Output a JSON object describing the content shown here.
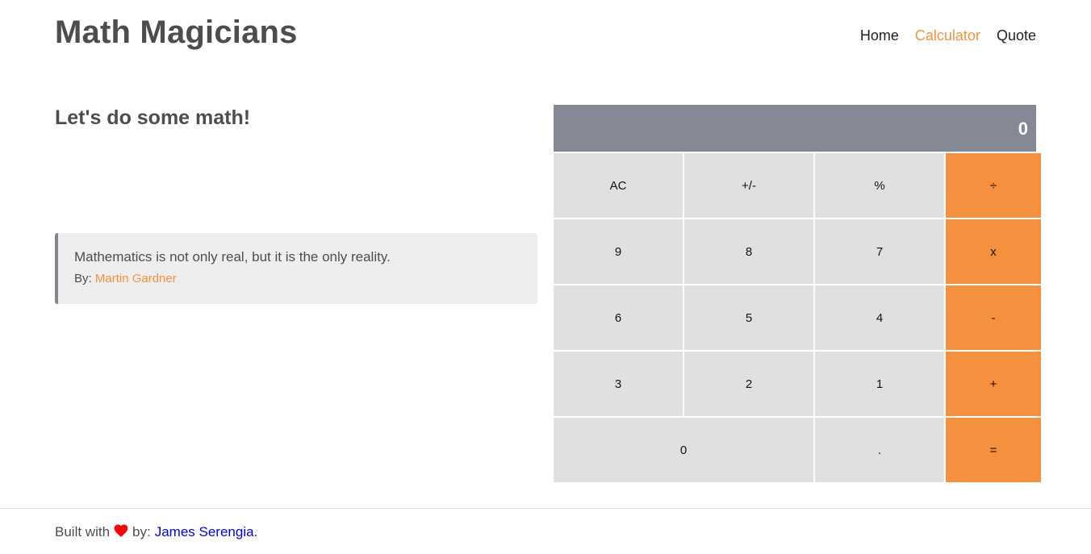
{
  "header": {
    "title": "Math Magicians",
    "nav": [
      {
        "label": "Home",
        "active": false
      },
      {
        "label": "Calculator",
        "active": true
      },
      {
        "label": "Quote",
        "active": false
      }
    ]
  },
  "main": {
    "heading": "Let's do some math!",
    "quote": {
      "text": "Mathematics is not only real, but it is the only reality.",
      "by_label": "By:",
      "author": "Martin Gardner"
    }
  },
  "calculator": {
    "display": "0",
    "keys": {
      "ac": "AC",
      "sign": "+/-",
      "percent": "%",
      "divide": "÷",
      "k9": "9",
      "k8": "8",
      "k7": "7",
      "multiply": "x",
      "k6": "6",
      "k5": "5",
      "k4": "4",
      "subtract": "-",
      "k3": "3",
      "k2": "2",
      "k1": "1",
      "add": "+",
      "k0": "0",
      "dot": ".",
      "equals": "="
    }
  },
  "footer": {
    "built_with": "Built with",
    "by": "by:",
    "author_link": "James Serengia.",
    "heart_icon": "heart-icon"
  },
  "colors": {
    "accent": "#f5913e",
    "display_bg": "#858895",
    "key_bg": "#e0e0e0",
    "quote_bg": "#eeeeee",
    "heart": "#ff0000",
    "link": "#0000ee"
  }
}
